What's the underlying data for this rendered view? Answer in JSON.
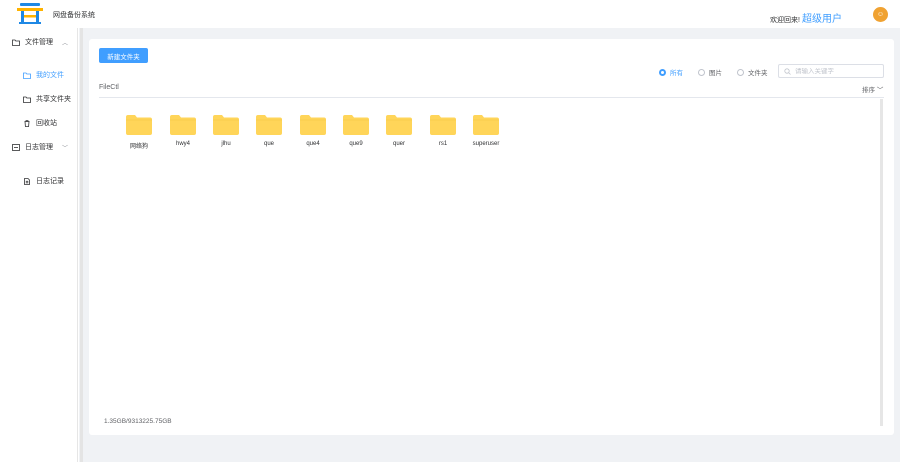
{
  "header": {
    "app_title": "网盘备份系统",
    "welcome": "欢迎回来!",
    "user": "超级用户",
    "avatar_text": "☺"
  },
  "sidebar": {
    "groups": [
      {
        "label": "文件管理",
        "icon": "folder-icon",
        "chevron": "chevron-up-icon"
      },
      {
        "label": "日志管理",
        "icon": "log-icon",
        "chevron": "chevron-down-icon"
      }
    ],
    "items": [
      {
        "label": "我的文件",
        "icon": "folder-open-icon",
        "active": true
      },
      {
        "label": "共享文件夹",
        "icon": "folder-open-icon",
        "active": false
      },
      {
        "label": "回收站",
        "icon": "trash-icon",
        "active": false
      },
      {
        "label": "日志记录",
        "icon": "document-icon",
        "active": false
      }
    ]
  },
  "toolbar": {
    "new_folder": "新建文件夹",
    "filters": [
      "所有",
      "图片",
      "文件夹"
    ],
    "selected_filter": "所有",
    "search_placeholder": "请输入关键字",
    "sort_label": "排序"
  },
  "path": "FileCtl",
  "folders": [
    "网络狗",
    "hwy4",
    "jlhu",
    "que",
    "que4",
    "que9",
    "quer",
    "rs1",
    "superuser"
  ],
  "usage": "1.35GB/9313225.75GB",
  "colors": {
    "accent": "#409eff",
    "folder": "#ffd559",
    "avatar": "#f0a232"
  }
}
